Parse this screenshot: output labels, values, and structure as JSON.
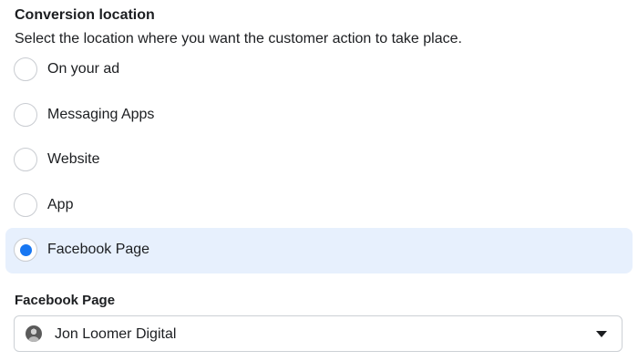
{
  "conversion_location": {
    "title": "Conversion location",
    "description": "Select the location where you want the customer action to take place.",
    "options": [
      {
        "label": "On your ad",
        "selected": false
      },
      {
        "label": "Messaging Apps",
        "selected": false
      },
      {
        "label": "Website",
        "selected": false
      },
      {
        "label": "App",
        "selected": false
      },
      {
        "label": "Facebook Page",
        "selected": true
      }
    ]
  },
  "facebook_page": {
    "label": "Facebook Page",
    "selected_value": "Jon Loomer Digital",
    "avatar_icon": "avatar",
    "dropdown_icon": "caret-down-icon"
  },
  "colors": {
    "accent": "#1877f2",
    "selected_background": "#e7f0fd",
    "border": "#ccd0d5"
  }
}
